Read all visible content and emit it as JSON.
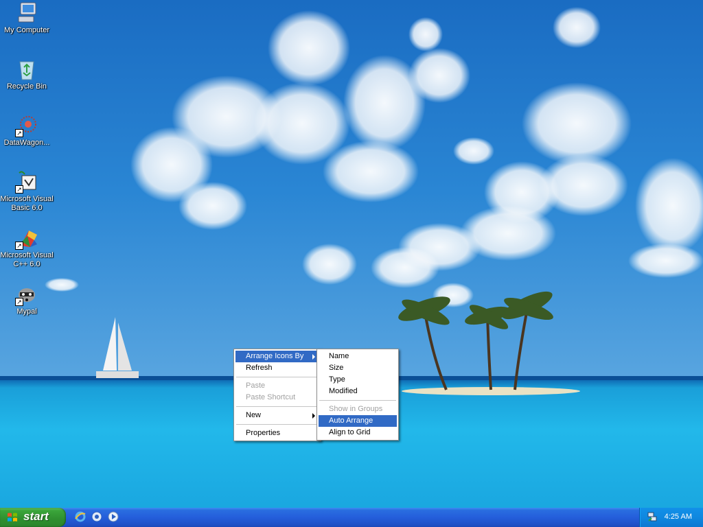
{
  "desktop": {
    "icons": [
      {
        "name": "My Computer",
        "icon": "my-computer-icon"
      },
      {
        "name": "Recycle Bin",
        "icon": "recycle-bin-icon"
      },
      {
        "name": "DataWagon...",
        "icon": "datawagon-icon"
      },
      {
        "name_line1": "Microsoft Visual",
        "name_line2": "Basic 6.0",
        "icon": "visual-basic-icon"
      },
      {
        "name_line1": "Microsoft Visual",
        "name_line2": "C++ 6.0",
        "icon": "visual-cpp-icon"
      },
      {
        "name": "Mypal",
        "icon": "mypal-raccoon-icon"
      }
    ]
  },
  "context_menu": {
    "items": [
      {
        "label": "Arrange Icons By",
        "state": "selected",
        "submenu": true
      },
      {
        "label": "Refresh",
        "state": "enabled"
      },
      {
        "label": "Paste",
        "state": "disabled"
      },
      {
        "label": "Paste Shortcut",
        "state": "disabled"
      },
      {
        "label": "New",
        "state": "enabled",
        "submenu": true
      },
      {
        "label": "Properties",
        "state": "enabled"
      }
    ]
  },
  "arrange_submenu": {
    "items": [
      {
        "label": "Name",
        "state": "enabled"
      },
      {
        "label": "Size",
        "state": "enabled"
      },
      {
        "label": "Type",
        "state": "enabled"
      },
      {
        "label": "Modified",
        "state": "enabled"
      },
      {
        "label": "Show in Groups",
        "state": "disabled"
      },
      {
        "label": "Auto Arrange",
        "state": "selected"
      },
      {
        "label": "Align to Grid",
        "state": "enabled"
      }
    ]
  },
  "taskbar": {
    "start_label": "start",
    "quick_launch": [
      "internet-explorer-icon",
      "media-icon",
      "show-desktop-icon"
    ],
    "tray": {
      "icons": [
        "network-icon"
      ],
      "clock": "4:25 AM"
    }
  },
  "colors": {
    "taskbar_blue": "#245edb",
    "start_green": "#3aa53a",
    "menu_highlight": "#316ac5",
    "tray_blue": "#0f88e0"
  }
}
